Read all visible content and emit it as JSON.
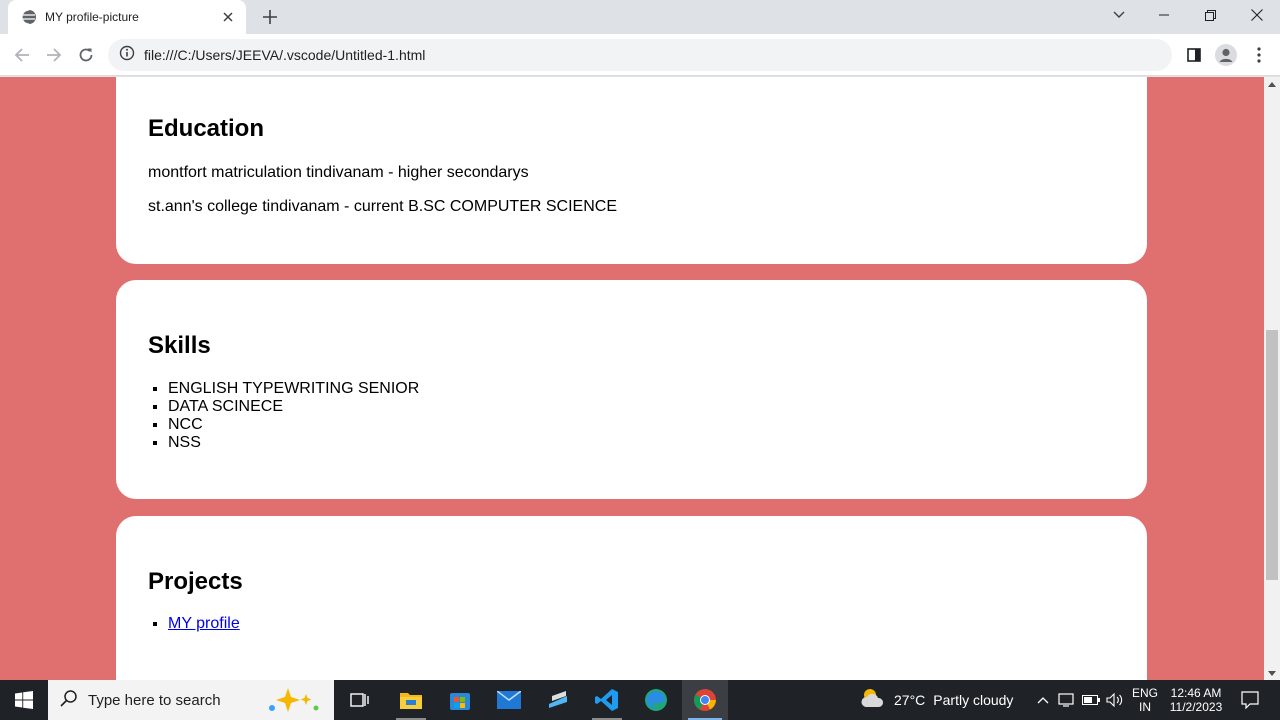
{
  "browser": {
    "tab_title": "MY profile-picture",
    "url": "file:///C:/Users/JEEVA/.vscode/Untitled-1.html"
  },
  "page": {
    "background_color": "#e07070",
    "education": {
      "heading": "Education",
      "items": [
        "montfort matriculation tindivanam - higher secondarys",
        "st.ann's college tindivanam - current B.SC COMPUTER SCIENCE"
      ]
    },
    "skills": {
      "heading": "Skills",
      "items": [
        "ENGLISH TYPEWRITING SENIOR",
        "DATA SCINECE",
        "NCC",
        "NSS"
      ]
    },
    "projects": {
      "heading": "Projects",
      "items": [
        "MY profile"
      ]
    }
  },
  "taskbar": {
    "search_placeholder": "Type here to search",
    "weather_temp": "27°C",
    "weather_desc": "Partly cloudy",
    "language": "ENG",
    "region": "IN",
    "time": "12:46 AM",
    "date": "11/2/2023"
  }
}
